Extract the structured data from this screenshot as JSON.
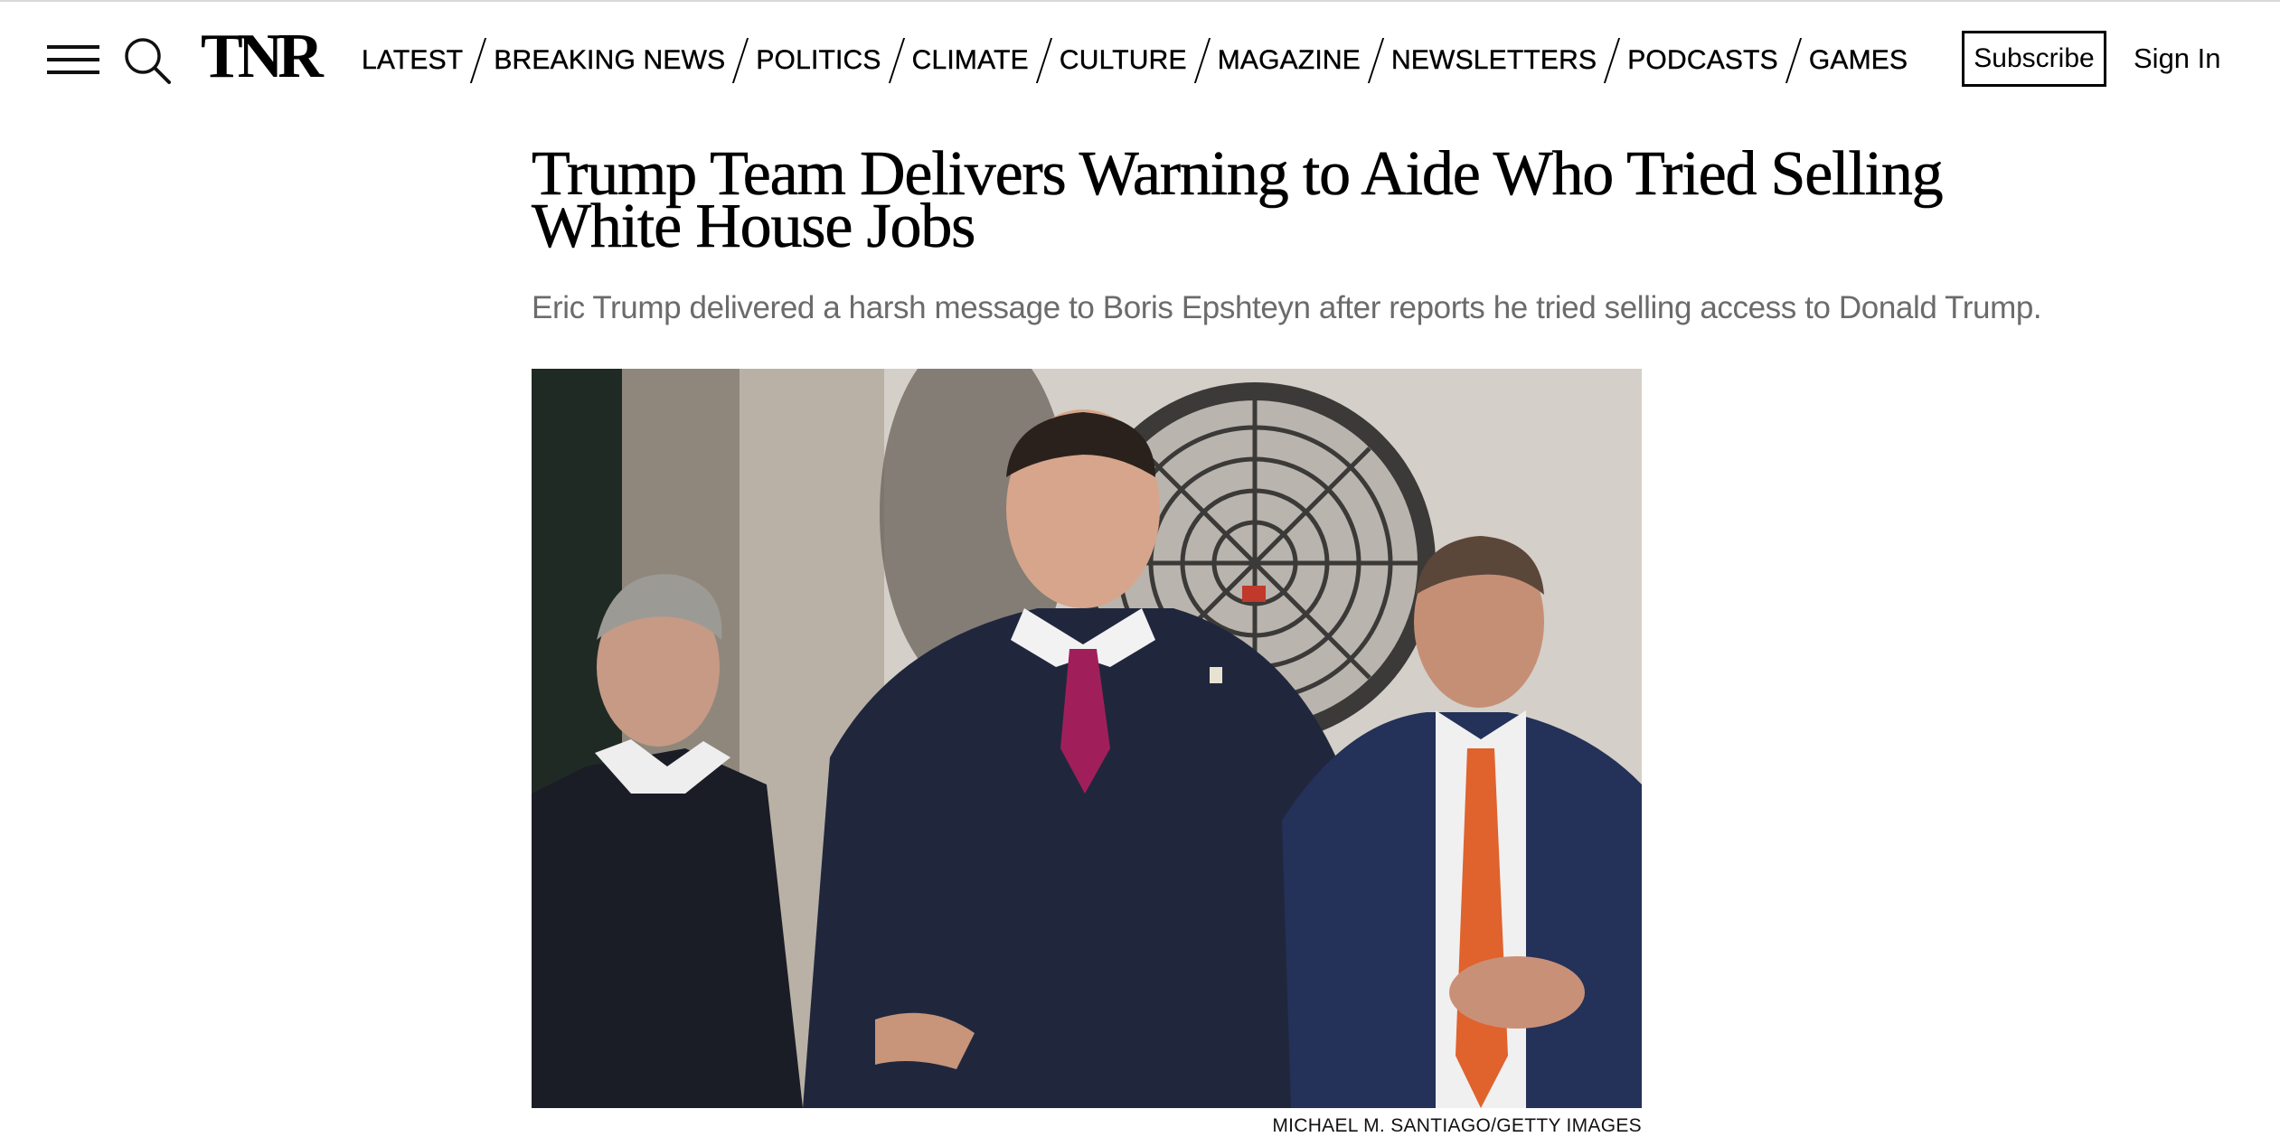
{
  "header": {
    "logo_text": "TNR",
    "nav": [
      {
        "label": "LATEST"
      },
      {
        "label": "BREAKING NEWS"
      },
      {
        "label": "POLITICS"
      },
      {
        "label": "CLIMATE"
      },
      {
        "label": "CULTURE"
      },
      {
        "label": "MAGAZINE"
      },
      {
        "label": "NEWSLETTERS"
      },
      {
        "label": "PODCASTS"
      },
      {
        "label": "GAMES"
      }
    ],
    "subscribe_label": "Subscribe",
    "signin_label": "Sign In",
    "menu_icon": "hamburger-menu-icon",
    "search_icon": "search-icon"
  },
  "article": {
    "headline": "Trump Team Delivers Warning to Aide Who Tried Selling White House Jobs",
    "dek": "Eric Trump delivered a harsh message to Boris Epshteyn after reports he tried selling access to Donald Trump.",
    "photo_credit": "MICHAEL M. SANTIAGO/GETTY IMAGES"
  }
}
